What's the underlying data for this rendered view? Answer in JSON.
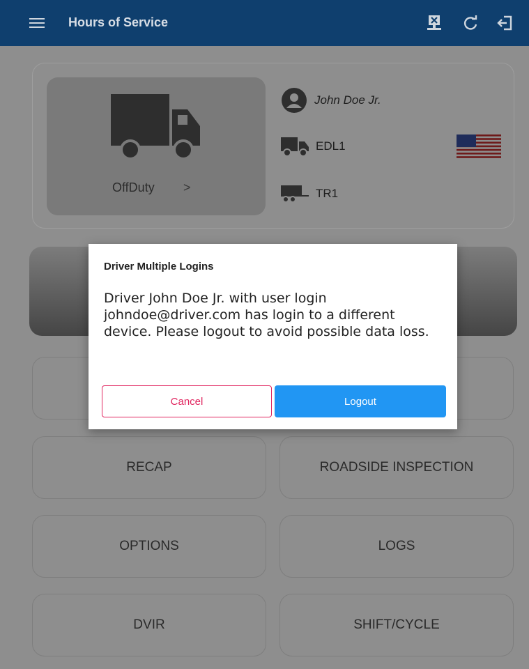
{
  "app_bar": {
    "title": "Hours of Service",
    "icons": [
      "menu-icon",
      "sync-cancel-icon",
      "refresh-icon",
      "logout-icon"
    ]
  },
  "profile": {
    "status_label": "OffDuty",
    "status_chevron": ">",
    "driver_name": "John Doe Jr.",
    "vehicle": "EDL1",
    "trailer": "TR1",
    "country_flag": "us-flag"
  },
  "menu_buttons": {
    "recap": "RECAP",
    "roadside_inspection": "ROADSIDE INSPECTION",
    "options": "OPTIONS",
    "logs": "LOGS",
    "dvir": "DVIR",
    "shift_cycle": "SHIFT/CYCLE"
  },
  "dialog": {
    "title": "Driver Multiple Logins",
    "message": "Driver John Doe Jr. with user login johndoe@driver.com has login to a different device. Please logout to avoid possible data loss.",
    "cancel_label": "Cancel",
    "logout_label": "Logout"
  },
  "colors": {
    "app_bar": "#0f3f6e",
    "overlay_bg": "#8e8e8e",
    "cancel_accent": "#e0245e",
    "logout_accent": "#2196f3"
  }
}
